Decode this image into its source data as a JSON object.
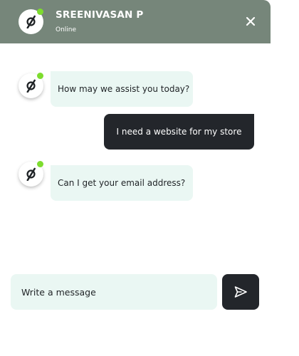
{
  "header": {
    "agent_name": "SREENIVASAN P",
    "status": "Online",
    "avatar_icon": "brand-logo-icon",
    "close_icon": "close-icon",
    "background_color": "#76867a",
    "online_color": "#7ddc2e"
  },
  "messages": [
    {
      "sender": "bot",
      "text": "How may we assist you today?"
    },
    {
      "sender": "user",
      "text": "I need a website for my store"
    },
    {
      "sender": "bot",
      "text": "Can I get your email address?"
    }
  ],
  "composer": {
    "placeholder": "Write a message",
    "send_icon": "send-icon"
  },
  "colors": {
    "bot_bubble": "#eaf7f3",
    "user_bubble": "#23262b",
    "send_button": "#23262b"
  }
}
